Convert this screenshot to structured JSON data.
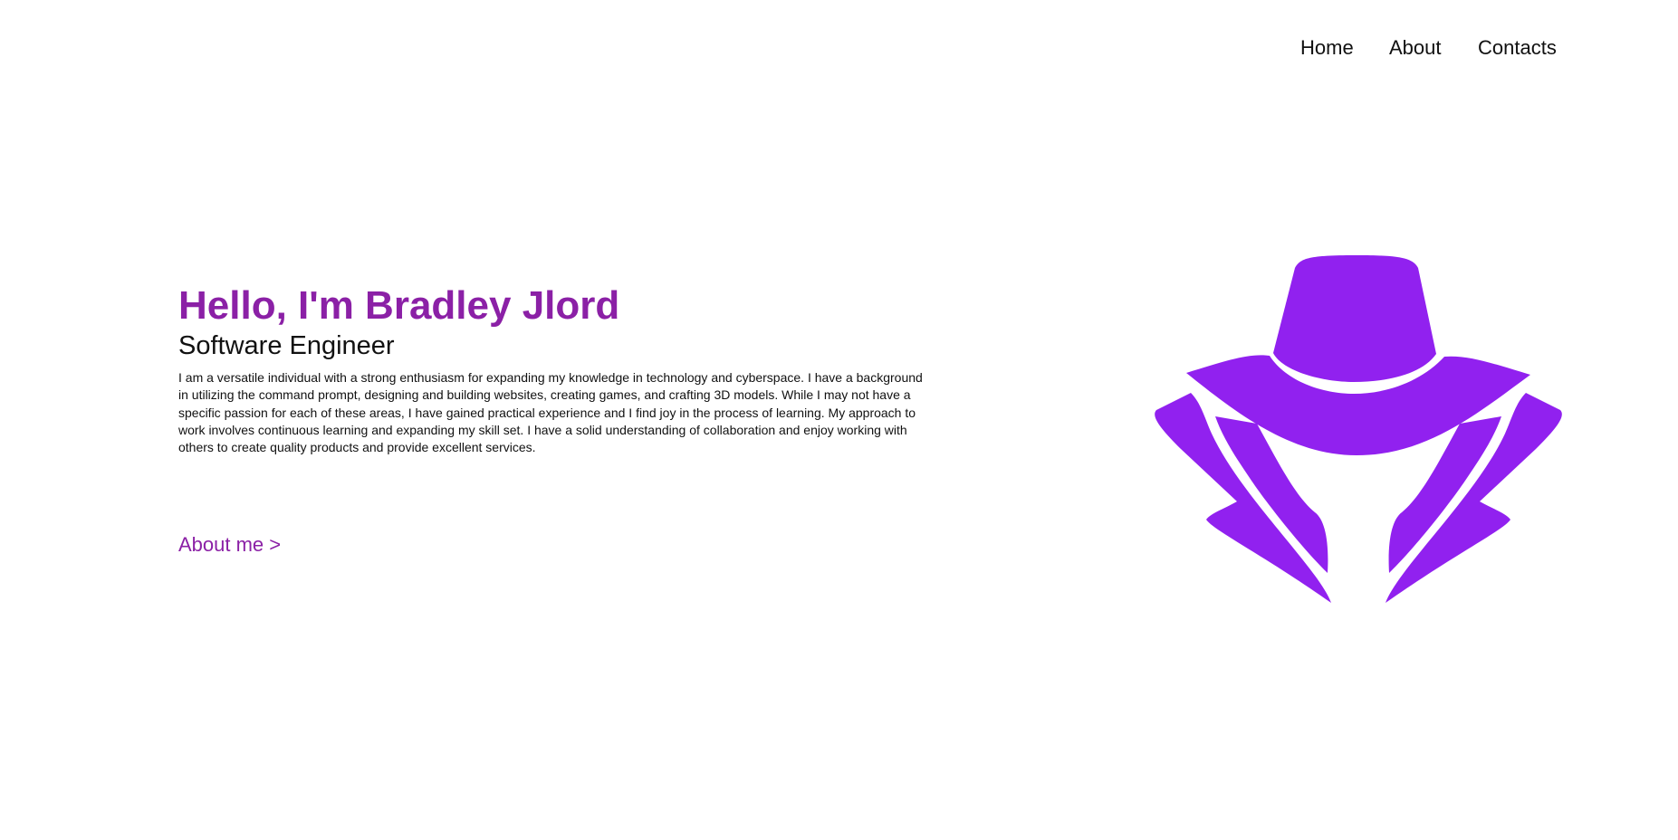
{
  "nav": {
    "links": [
      {
        "label": "Home"
      },
      {
        "label": "About"
      },
      {
        "label": "Contacts"
      }
    ]
  },
  "hero": {
    "title": "Hello, I'm Bradley Jlord",
    "subtitle": "Software Engineer",
    "bio": "I am a versatile individual with a strong enthusiasm for expanding my knowledge in technology and cyberspace. I have a background in utilizing the command prompt, designing and building websites, creating games, and crafting 3D models. While I may not have a specific passion for each of these areas, I have gained practical experience and I find joy in the process of learning. My approach to work involves continuous learning and expanding my skill set. I have a solid understanding of collaboration and enjoy working with others to create quality products and provide excellent services.",
    "cta_label": "About me >"
  },
  "logo": {
    "icon": "spy-hat-coat-icon",
    "color": "#9121ef"
  },
  "colors": {
    "accent": "#8b20a6",
    "text": "#111111",
    "background": "#ffffff"
  }
}
